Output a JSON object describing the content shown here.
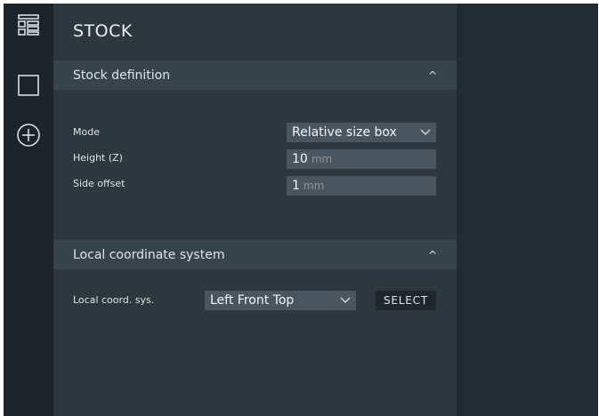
{
  "rail": {
    "items": [
      {
        "icon": "layout-tree-icon"
      },
      {
        "icon": "stock-box-icon"
      },
      {
        "icon": "add-circle-icon"
      }
    ]
  },
  "panel": {
    "title": "STOCK",
    "stock_definition": {
      "header": "Stock definition",
      "mode_label": "Mode",
      "mode_value": "Relative size box",
      "height_label": "Height (Z)",
      "height_value": "10",
      "height_unit": "mm",
      "side_offset_label": "Side offset",
      "side_offset_value": "1",
      "side_offset_unit": "mm"
    },
    "local_coordinate_system": {
      "header": "Local coordinate system",
      "lcs_label": "Local coord. sys.",
      "lcs_value": "Left Front Top",
      "select_button": "SELECT"
    }
  },
  "colors": {
    "rail_bg": "#1c2429",
    "panel_bg": "#2d373e",
    "section_header_bg": "#38444c",
    "field_bg": "#4a565f",
    "button_bg": "#1f272c"
  }
}
